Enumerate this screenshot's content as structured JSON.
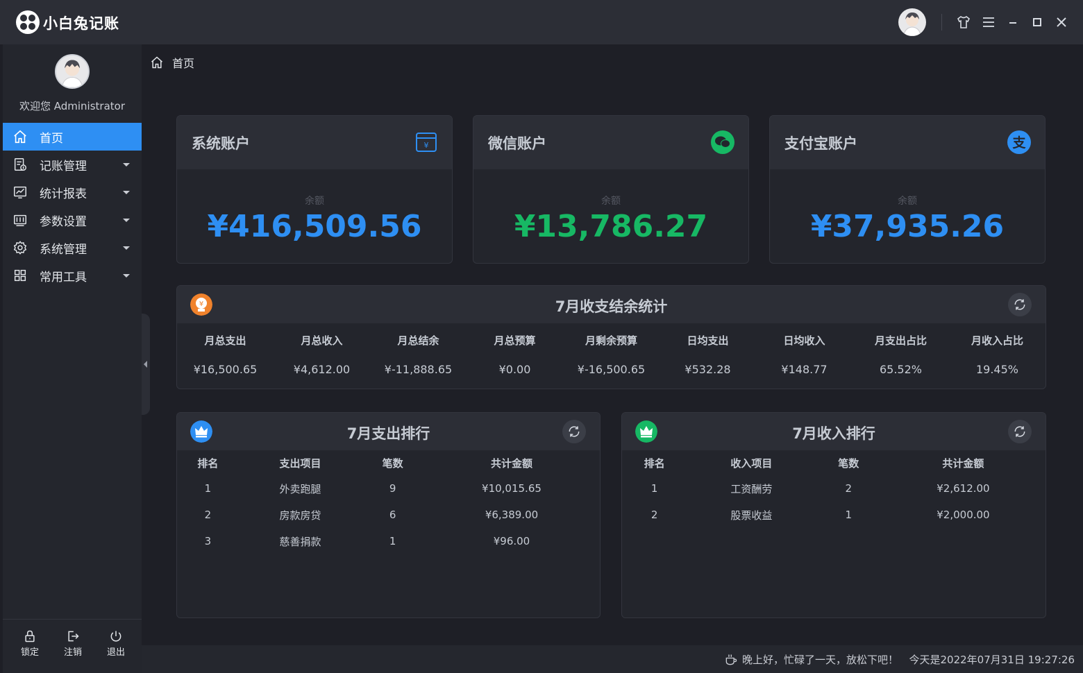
{
  "app": {
    "title": "小白兔记账"
  },
  "titlebar": {
    "buttons": [
      {
        "name": "skin-icon"
      },
      {
        "name": "menu-icon"
      },
      {
        "name": "minimize-icon"
      },
      {
        "name": "maximize-icon"
      },
      {
        "name": "close-icon"
      }
    ]
  },
  "sidebar": {
    "welcome": "欢迎您 Administrator",
    "items": [
      {
        "label": "首页",
        "icon": "home-icon",
        "active": true,
        "has_submenu": false
      },
      {
        "label": "记账管理",
        "icon": "ledger-icon",
        "active": false,
        "has_submenu": true
      },
      {
        "label": "统计报表",
        "icon": "report-chart-icon",
        "active": false,
        "has_submenu": true
      },
      {
        "label": "参数设置",
        "icon": "settings-panel-icon",
        "active": false,
        "has_submenu": true
      },
      {
        "label": "系统管理",
        "icon": "gear-icon",
        "active": false,
        "has_submenu": true
      },
      {
        "label": "常用工具",
        "icon": "grid-icon",
        "active": false,
        "has_submenu": true
      }
    ],
    "bottom": [
      {
        "label": "锁定",
        "icon": "lock-icon"
      },
      {
        "label": "注销",
        "icon": "logout-icon"
      },
      {
        "label": "退出",
        "icon": "power-icon"
      }
    ]
  },
  "breadcrumb": {
    "label": "首页",
    "icon": "home-icon"
  },
  "accounts": [
    {
      "title": "系统账户",
      "sub": "余额",
      "amount": "¥416,509.56",
      "color": "#2e8ff3",
      "icon": "wallet-yuan-icon"
    },
    {
      "title": "微信账户",
      "sub": "余额",
      "amount": "¥13,786.27",
      "color": "#17b864",
      "icon": "wechat-icon"
    },
    {
      "title": "支付宝账户",
      "sub": "余额",
      "amount": "¥37,935.26",
      "color": "#2e8ff3",
      "icon": "alipay-icon"
    }
  ],
  "monthly": {
    "title": "7月收支结余统计",
    "badge_icon": "yuan-badge-icon",
    "columns": [
      {
        "label": "月总支出",
        "value": "¥16,500.65"
      },
      {
        "label": "月总收入",
        "value": "¥4,612.00"
      },
      {
        "label": "月总结余",
        "value": "¥-11,888.65"
      },
      {
        "label": "月总预算",
        "value": "¥0.00"
      },
      {
        "label": "月剩余预算",
        "value": "¥-16,500.65"
      },
      {
        "label": "日均支出",
        "value": "¥532.28"
      },
      {
        "label": "日均收入",
        "value": "¥148.77"
      },
      {
        "label": "月支出占比",
        "value": "65.52%"
      },
      {
        "label": "月收入占比",
        "value": "19.45%"
      }
    ]
  },
  "expense_rank": {
    "title": "7月支出排行",
    "headers": [
      "排名",
      "支出项目",
      "笔数",
      "共计金额"
    ],
    "rows": [
      [
        "1",
        "外卖跑腿",
        "9",
        "¥10,015.65"
      ],
      [
        "2",
        "房款房贷",
        "6",
        "¥6,389.00"
      ],
      [
        "3",
        "慈善捐款",
        "1",
        "¥96.00"
      ]
    ],
    "badge_color": "#2e8ff3"
  },
  "income_rank": {
    "title": "7月收入排行",
    "headers": [
      "排名",
      "收入项目",
      "笔数",
      "共计金额"
    ],
    "rows": [
      [
        "1",
        "工资酬劳",
        "2",
        "¥2,612.00"
      ],
      [
        "2",
        "股票收益",
        "1",
        "¥2,000.00"
      ]
    ],
    "badge_color": "#17b864"
  },
  "status": {
    "greeting": "晚上好，忙碌了一天，放松下吧！",
    "datetime": "今天是2022年07月31日 19:27:26"
  }
}
